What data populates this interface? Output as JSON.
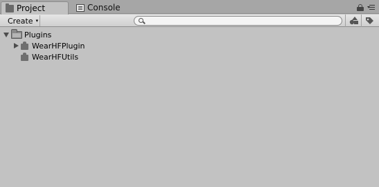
{
  "tabs": [
    {
      "label": "Project",
      "icon": "folder-icon",
      "active": true
    },
    {
      "label": "Console",
      "icon": "console-icon",
      "active": false
    }
  ],
  "toolbar": {
    "create_label": "Create",
    "create_caret": "▾",
    "search_value": "",
    "search_placeholder": ""
  },
  "tree": {
    "root": {
      "label": "Plugins",
      "expanded": true
    },
    "children": [
      {
        "label": "WearHFPlugin",
        "expandable": true
      },
      {
        "label": "WearHFUtils",
        "expandable": false
      }
    ]
  },
  "colors": {
    "panel_bg": "#c2c2c2",
    "tabbar_bg": "#a6a6a6",
    "icon_gray": "#6f6f6f"
  }
}
